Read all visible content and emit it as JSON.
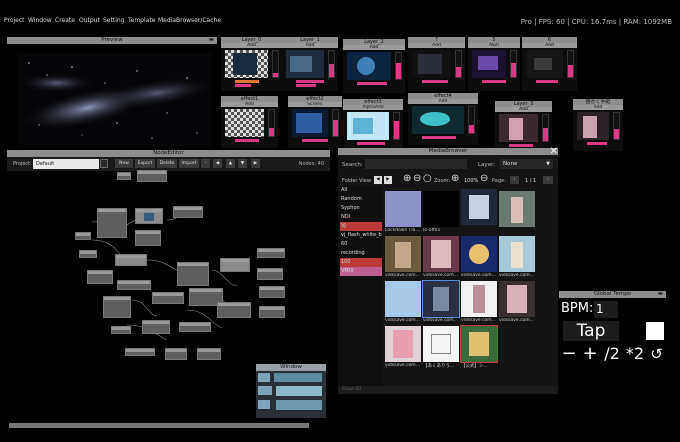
{
  "menu": [
    "Project",
    "Window",
    "Create",
    "Output",
    "Setting",
    "Template",
    "MediaBrowser/Cache"
  ],
  "stats": "Pro | FPS: 60 | CPU: 16.7ms | RAM: 1092MB",
  "preview": {
    "title": "Preview"
  },
  "layers": [
    {
      "name": "Layer_0",
      "blend": "Add",
      "value": 0.15
    },
    {
      "name": "Layer_1",
      "blend": "Add",
      "value": 0.5
    },
    {
      "name": "Layer_2",
      "blend": "Add",
      "value": 0.6
    },
    {
      "name": "7",
      "blend": "Add",
      "value": 0.4
    },
    {
      "name": "5",
      "blend": "Alph",
      "value": 0.55
    },
    {
      "name": "6",
      "blend": "Add",
      "value": 0.45
    },
    {
      "name": "effect1",
      "blend": "Add",
      "value": 0.3
    },
    {
      "name": "effect2",
      "blend": "Screen",
      "value": 0.6
    },
    {
      "name": "effect3",
      "blend": "AlphaAdd",
      "value": 0.7
    },
    {
      "name": "effect4",
      "blend": "Add",
      "value": 0.3
    },
    {
      "name": "Layer_3",
      "blend": "Add",
      "value": 0.5
    },
    {
      "name": "描かく手紙",
      "blend": "Add",
      "value": 0.4
    }
  ],
  "node_editor": {
    "title": "NodeEditor",
    "project_label": "Project:",
    "project_value": "Default",
    "buttons": [
      "New",
      "Export",
      "Delete",
      "Import"
    ],
    "nodes_label": "Nodes: 40"
  },
  "media_browser": {
    "title": "MediaBrowser",
    "search_label": "Search:",
    "layer_label": "Layer:",
    "layer_value": "None",
    "folder_view_label": "Folder View",
    "zoom_label": "Zoom:",
    "zoom_value": "100%",
    "page_label": "Page:",
    "page_value": "1 / 1",
    "folders": [
      "All",
      "Random",
      "Syphon",
      "NDI",
      "VJ",
      "vj_flash_white_bla",
      "60",
      "recording",
      "100",
      "VMIX"
    ],
    "thumbnails": [
      "Lockdown (Ta...",
      "lo-off01",
      "",
      "",
      "vidssave.com...",
      "vidssave.com...",
      "vidssave.com...",
      "vidssave.com...",
      "vidssave.com...",
      "vidssave.com...",
      "vidssave.com...",
      "vidssave.com...",
      "vidssave.com...",
      "【あくありう...",
      "【公式】シ..."
    ],
    "footer": "Clear (E)"
  },
  "tempo": {
    "title": "Global Tempo",
    "bpm_label": "BPM:",
    "bpm_value": "1",
    "tap_label": "Tap",
    "buttons": [
      "−",
      "+",
      "/2",
      "*2"
    ]
  },
  "mini_window": {
    "title": "Window"
  },
  "colors": {
    "accent": "#d93a83",
    "titlebar": "#8d8d8d",
    "selected_folder": "#b83a3a"
  }
}
